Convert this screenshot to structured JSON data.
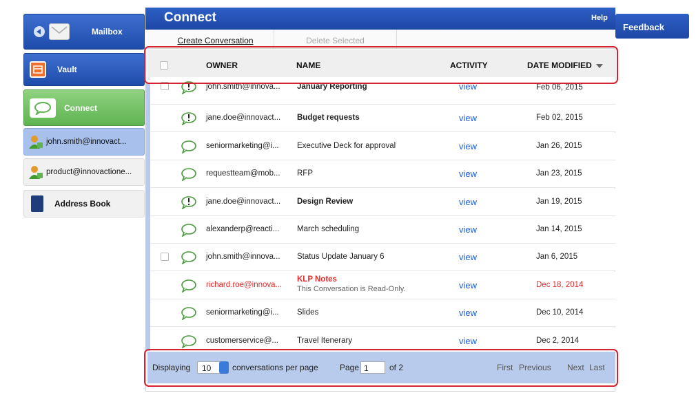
{
  "sidebar": {
    "mailbox": "Mailbox",
    "vault": "Vault",
    "connect": "Connect",
    "account1": "john.smith@innovact...",
    "account2": "product@innovactione...",
    "address_book": "Address Book"
  },
  "header": {
    "title": "Connect",
    "help": "Help",
    "feedback": "Feedback"
  },
  "toolbar": {
    "create": "Create Conversation",
    "delete": "Delete Selected"
  },
  "columns": {
    "owner": "OWNER",
    "name": "NAME",
    "activity": "ACTIVITY",
    "date": "DATE MODIFIED"
  },
  "rows": [
    {
      "owner": "john.smith@innova...",
      "name": "January Reporting",
      "activity": "view",
      "date": "Feb 06, 2015",
      "bold": true,
      "icon": "alert-bubble-icon"
    },
    {
      "owner": "jane.doe@innovact...",
      "name": "Budget requests",
      "activity": "view",
      "date": "Feb 02, 2015",
      "bold": true,
      "icon": "alert-bubble-icon"
    },
    {
      "owner": "seniormarketing@i...",
      "name": "Executive Deck for approval",
      "activity": "view",
      "date": "Jan 26, 2015",
      "icon": "chat-bubble-icon"
    },
    {
      "owner": "requestteam@mob...",
      "name": "RFP",
      "activity": "view",
      "date": "Jan 23, 2015",
      "icon": "chat-bubble-icon"
    },
    {
      "owner": "jane.doe@innovact...",
      "name": "Design Review",
      "activity": "view",
      "date": "Jan 19, 2015",
      "bold": true,
      "icon": "alert-bubble-icon"
    },
    {
      "owner": "alexanderp@reacti...",
      "name": "March scheduling",
      "activity": "view",
      "date": "Jan 14, 2015",
      "icon": "chat-bubble-icon"
    },
    {
      "owner": "john.smith@innova...",
      "name": "Status Update January 6",
      "activity": "view",
      "date": "Jan 6, 2015",
      "icon": "chat-bubble-icon"
    },
    {
      "owner": "richard.roe@innova...",
      "name": "KLP Notes",
      "sub": "This Conversation is Read-Only.",
      "activity": "view",
      "date": "Dec 18, 2014",
      "red": true,
      "icon": "chat-bubble-icon"
    },
    {
      "owner": "seniormarketing@i...",
      "name": "Slides",
      "activity": "view",
      "date": "Dec 10, 2014",
      "icon": "chat-bubble-icon"
    },
    {
      "owner": "customerservice@...",
      "name": "Travel Itenerary",
      "activity": "view",
      "date": "Dec 2, 2014",
      "icon": "chat-bubble-icon"
    }
  ],
  "footer": {
    "displaying": "Displaying",
    "per_page": "10",
    "per_page_suffix": "conversations per page",
    "page_label": "Page",
    "page_value": "1",
    "of": "of 2",
    "first": "First",
    "previous": "Previous",
    "next": "Next",
    "last": "Last"
  },
  "colors": {
    "blue": "#1e47a6",
    "green": "#5fb451",
    "highlight": "#d6222e",
    "link": "#1f5fd9"
  }
}
